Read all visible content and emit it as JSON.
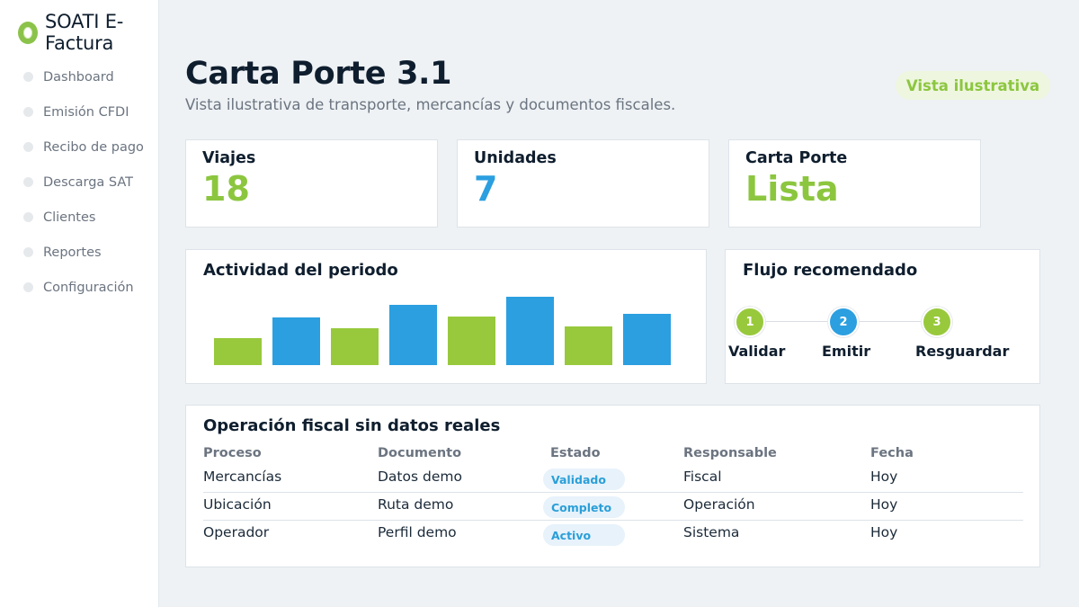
{
  "brand": {
    "name": "SOATI E-Factura",
    "color": "#8bc34a"
  },
  "nav": {
    "items": [
      {
        "label": "Dashboard"
      },
      {
        "label": "Emisión CFDI"
      },
      {
        "label": "Recibo de pago"
      },
      {
        "label": "Descarga SAT"
      },
      {
        "label": "Clientes"
      },
      {
        "label": "Reportes"
      },
      {
        "label": "Configuración"
      }
    ]
  },
  "header": {
    "title": "Carta Porte 3.1",
    "subtitle": "Vista ilustrativa de transporte, mercancías y documentos fiscales.",
    "badge": "Vista ilustrativa"
  },
  "stats": [
    {
      "label": "Viajes",
      "value": "18",
      "color": "#8cc63f"
    },
    {
      "label": "Unidades",
      "value": "7",
      "color": "#2b9fe0"
    },
    {
      "label": "Carta Porte",
      "value": "Lista",
      "color": "#8cc63f"
    }
  ],
  "activity": {
    "title": "Actividad del periodo",
    "colors": [
      "#98c93c",
      "#2b9fe0"
    ]
  },
  "chart_data": {
    "type": "bar",
    "title": "Actividad del periodo",
    "categories": [
      "",
      "",
      "",
      "",
      "",
      "",
      "",
      ""
    ],
    "values": [
      26,
      45,
      35,
      57,
      46,
      65,
      37,
      49
    ],
    "colors": [
      "#98c93c",
      "#2b9fe0",
      "#98c93c",
      "#2b9fe0",
      "#98c93c",
      "#2b9fe0",
      "#98c93c",
      "#2b9fe0"
    ],
    "ylim": [
      0,
      70
    ],
    "grid": false
  },
  "flow": {
    "title": "Flujo recomendado",
    "steps": [
      {
        "number": "1",
        "label": "Validar",
        "color": "#98c93c"
      },
      {
        "number": "2",
        "label": "Emitir",
        "color": "#2b9fe0"
      },
      {
        "number": "3",
        "label": "Resguardar",
        "color": "#98c93c"
      }
    ]
  },
  "table": {
    "title": "Operación fiscal sin datos reales",
    "headers": [
      "Proceso",
      "Documento",
      "Estado",
      "Responsable",
      "Fecha"
    ],
    "rows": [
      {
        "proceso": "Mercancías",
        "documento": "Datos demo",
        "estado": "Validado",
        "responsable": "Fiscal",
        "fecha": "Hoy"
      },
      {
        "proceso": "Ubicación",
        "documento": "Ruta demo",
        "estado": "Completo",
        "responsable": "Operación",
        "fecha": "Hoy"
      },
      {
        "proceso": "Operador",
        "documento": "Perfil demo",
        "estado": "Activo",
        "responsable": "Sistema",
        "fecha": "Hoy"
      }
    ]
  }
}
